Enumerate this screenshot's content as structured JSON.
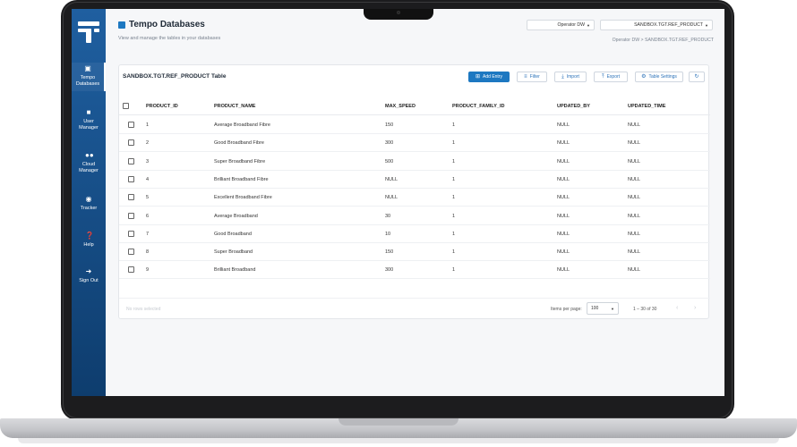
{
  "app": {
    "title": "Tempo Databases",
    "subtitle": "View and manage the tables in your databases"
  },
  "header": {
    "operator_select": "Operator DW",
    "table_select": "SANDBOX.TGT.REF_PRODUCT",
    "breadcrumb": "Operator DW > SANDBOX.TGT.REF_PRODUCT"
  },
  "sidebar": {
    "items": [
      {
        "label1": "Tempo",
        "label2": "Databases"
      },
      {
        "label1": "User",
        "label2": "Manager"
      },
      {
        "label1": "Cloud",
        "label2": "Manager"
      },
      {
        "label1": "Tracker",
        "label2": ""
      },
      {
        "label1": "Help",
        "label2": ""
      },
      {
        "label1": "Sign Out",
        "label2": ""
      }
    ]
  },
  "card": {
    "title": "SANDBOX.TGT.REF_PRODUCT Table",
    "buttons": {
      "add_entry": "Add Entry",
      "filter": "Filter",
      "import": "Import",
      "export": "Export",
      "table_settings": "Table Settings"
    }
  },
  "table": {
    "columns": [
      "PRODUCT_ID",
      "PRODUCT_NAME",
      "MAX_SPEED",
      "PRODUCT_FAMILY_ID",
      "UPDATED_BY",
      "UPDATED_TIME"
    ],
    "rows": [
      [
        "1",
        "Average Broadband Fibre",
        "150",
        "1",
        "NULL",
        "NULL"
      ],
      [
        "2",
        "Good Broadband Fibre",
        "300",
        "1",
        "NULL",
        "NULL"
      ],
      [
        "3",
        "Super Broadband Fibre",
        "500",
        "1",
        "NULL",
        "NULL"
      ],
      [
        "4",
        "Brilliant Broadband Fibre",
        "NULL",
        "1",
        "NULL",
        "NULL"
      ],
      [
        "5",
        "Excellent Broadband Fibre",
        "NULL",
        "1",
        "NULL",
        "NULL"
      ],
      [
        "6",
        "Average Broadband",
        "30",
        "1",
        "NULL",
        "NULL"
      ],
      [
        "7",
        "Good Broadband",
        "10",
        "1",
        "NULL",
        "NULL"
      ],
      [
        "8",
        "Super Broadband",
        "150",
        "1",
        "NULL",
        "NULL"
      ],
      [
        "9",
        "Brilliant Broadband",
        "300",
        "1",
        "NULL",
        "NULL"
      ]
    ]
  },
  "footer": {
    "no_selection": "No rows selected",
    "items_per_page_label": "Items per page:",
    "items_per_page_value": "100",
    "range": "1 – 30 of 30"
  },
  "colors": {
    "accent": "#1d78c1",
    "sidebar_top": "#1f5fa0",
    "sidebar_bottom": "#0e3d6e"
  }
}
